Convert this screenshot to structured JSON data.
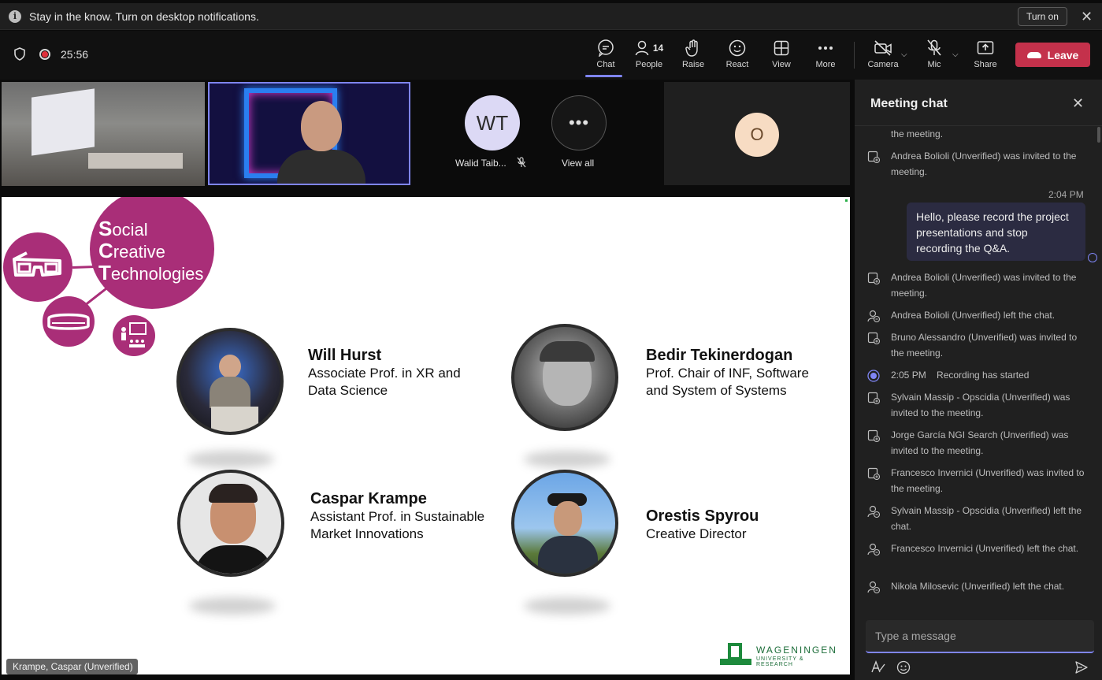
{
  "notification": {
    "text": "Stay in the know. Turn on desktop notifications.",
    "button": "Turn on"
  },
  "toolbar": {
    "timer": "25:56",
    "chat_label": "Chat",
    "people_label": "People",
    "people_count": "14",
    "raise_label": "Raise",
    "react_label": "React",
    "view_label": "View",
    "more_label": "More",
    "camera_label": "Camera",
    "mic_label": "Mic",
    "share_label": "Share",
    "leave_label": "Leave"
  },
  "strip": {
    "wt_initials": "WT",
    "wt_name": "Walid Taib...",
    "view_all": "View all",
    "o_initial": "O"
  },
  "slide": {
    "sct_s": "S",
    "sct_ocial": "ocial",
    "sct_c": "C",
    "sct_reative": "reative",
    "sct_t": "T",
    "sct_echnologies": "echnologies",
    "people": [
      {
        "name": "Will Hurst",
        "role1": "Associate Prof. in XR and",
        "role2": "Data Science"
      },
      {
        "name": "Bedir Tekinerdogan",
        "role1": "Prof. Chair of INF, Software",
        "role2": "and System of Systems"
      },
      {
        "name": "Caspar Krampe",
        "role1": "Assistant Prof. in Sustainable",
        "role2": "Market Innovations"
      },
      {
        "name": "Orestis Spyrou",
        "role1": "Creative Director",
        "role2": ""
      }
    ],
    "logo_main": "WAGENINGEN",
    "logo_sub": "UNIVERSITY & RESEARCH",
    "caption": "Krampe, Caspar (Unverified)"
  },
  "chat": {
    "title": "Meeting chat",
    "events": [
      {
        "icon": "invite-icon",
        "text": "the meeting."
      },
      {
        "icon": "invite-icon",
        "text": "Andrea Bolioli (Unverified) was invited to the meeting."
      },
      {
        "icon": "invite-icon",
        "text": "Andrea Bolioli (Unverified) was invited to the meeting."
      },
      {
        "icon": "leave-icon",
        "text": "Andrea Bolioli (Unverified) left the chat."
      },
      {
        "icon": "invite-icon",
        "text": "Bruno Alessandro (Unverified) was invited to the meeting."
      },
      {
        "icon": "record-icon",
        "text": "2:05 PM    Recording has started"
      },
      {
        "icon": "invite-icon",
        "text": "Sylvain Massip - Opscidia (Unverified) was invited to the meeting."
      },
      {
        "icon": "invite-icon",
        "text": "Jorge García NGI Search (Unverified) was invited to the meeting."
      },
      {
        "icon": "invite-icon",
        "text": "Francesco Invernici (Unverified) was invited to the meeting."
      },
      {
        "icon": "leave-icon",
        "text": "Sylvain Massip - Opscidia (Unverified) left the chat."
      },
      {
        "icon": "leave-icon",
        "text": "Francesco Invernici (Unverified) left the chat."
      },
      {
        "icon": "leave-icon",
        "text": "Nikola Milosevic (Unverified) left the chat."
      }
    ],
    "message_time": "2:04 PM",
    "message_text": "Hello, please record the project presentations and stop recording the Q&A.",
    "composer_placeholder": "Type a message"
  }
}
